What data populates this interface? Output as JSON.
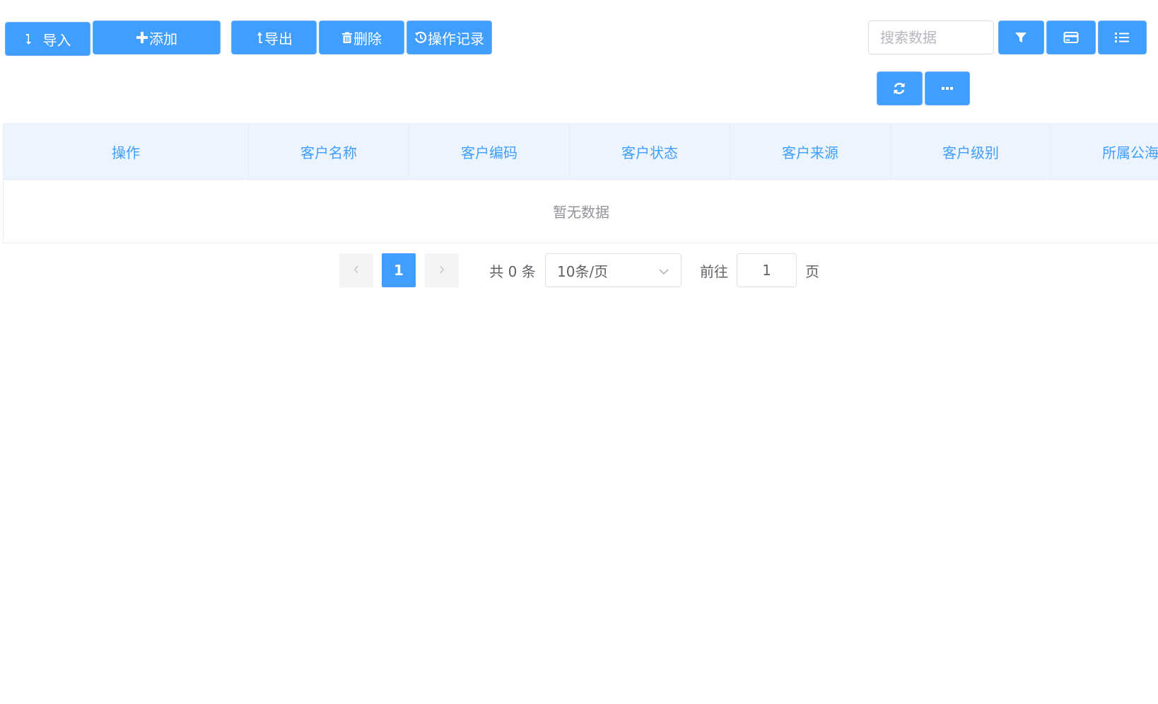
{
  "toolbar": {
    "import_label": "导入",
    "add_label": "添加",
    "export_label": "导出",
    "delete_label": "删除",
    "log_label": "操作记录"
  },
  "search": {
    "placeholder": "搜索数据"
  },
  "right_tools": {
    "icons": [
      "filter-icon",
      "card-icon",
      "list-icon",
      "refresh-icon",
      "more-icon"
    ]
  },
  "table": {
    "columns": [
      "操作",
      "客户名称",
      "客户编码",
      "客户状态",
      "客户来源",
      "客户级别",
      "所属公海"
    ],
    "empty_text": "暂无数据"
  },
  "pagination": {
    "current_page": "1",
    "total_text": "共 0 条",
    "page_size": "10条/页",
    "goto_label": "前往",
    "goto_value": "1",
    "page_suffix": "页"
  },
  "colors": {
    "primary": "#409eff",
    "header_bg": "#ecf5ff",
    "text": "#606266",
    "muted": "#909399"
  }
}
